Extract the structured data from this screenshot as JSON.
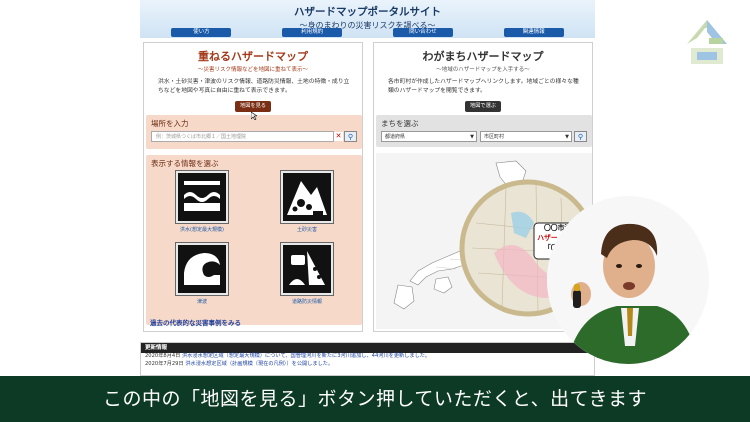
{
  "header": {
    "title": "ハザードマップポータルサイト",
    "subtitle": "～身のまわりの災害リスクを調べる～",
    "nav": [
      "使い方",
      "利用規約",
      "問い合わせ",
      "関連情報"
    ]
  },
  "left_panel": {
    "title": "重ねるハザードマップ",
    "subtitle": "～災害リスク情報などを地図に重ねて表示～",
    "description": "洪水・土砂災害・津波のリスク情報、道路防災情報、土地の特徴・成り立ちなどを地図や写真に自由に重ねて表示できます。",
    "map_button": "地図を見る",
    "location_label": "場所を入力",
    "location_placeholder": "例：茨城県つくば市北郷１／国土地理院",
    "info_label": "表示する情報を選ぶ",
    "tiles": [
      {
        "label": "洪水(想定最大規模)",
        "icon": "flood-icon"
      },
      {
        "label": "土砂災害",
        "icon": "landslide-icon"
      },
      {
        "label": "津波",
        "icon": "tsunami-icon"
      },
      {
        "label": "道路防災情報",
        "icon": "road-disaster-icon"
      }
    ],
    "past_link": "過去の代表的な災害事例をみる"
  },
  "right_panel": {
    "title": "わがまちハザードマップ",
    "subtitle": "～地域のハザードマップを入手する～",
    "description": "各市町村が作成したハザードマップへリンクします。地域ごとの様々な種類のハザードマップを閲覧できます。",
    "map_button": "地図で選ぶ",
    "town_label": "まちを選ぶ",
    "prefecture_select": "都道府県",
    "city_select": "市区町村",
    "map_badge": [
      "〇〇市洪水",
      "ハザードマップ",
      "「〇〇版」"
    ]
  },
  "updates": {
    "header": "更新情報",
    "rows": [
      {
        "date": "2020年8月4日",
        "text": "洪水浸水想定区域（想定最大規模）について、国管理河川を新たに3河川追加し、44河川を更新しました。"
      },
      {
        "date": "2020年7月29日",
        "text": "洪水浸水想定区域（計画規模（現在の凡例））を公開しました。"
      }
    ]
  },
  "caption": "この中の「地図を見る」ボタン押していただくと、出てきます",
  "colors": {
    "subtitle_bar": "#0c3a24",
    "left_accent": "#7a2e14",
    "nav_blue": "#1a5aa8"
  }
}
